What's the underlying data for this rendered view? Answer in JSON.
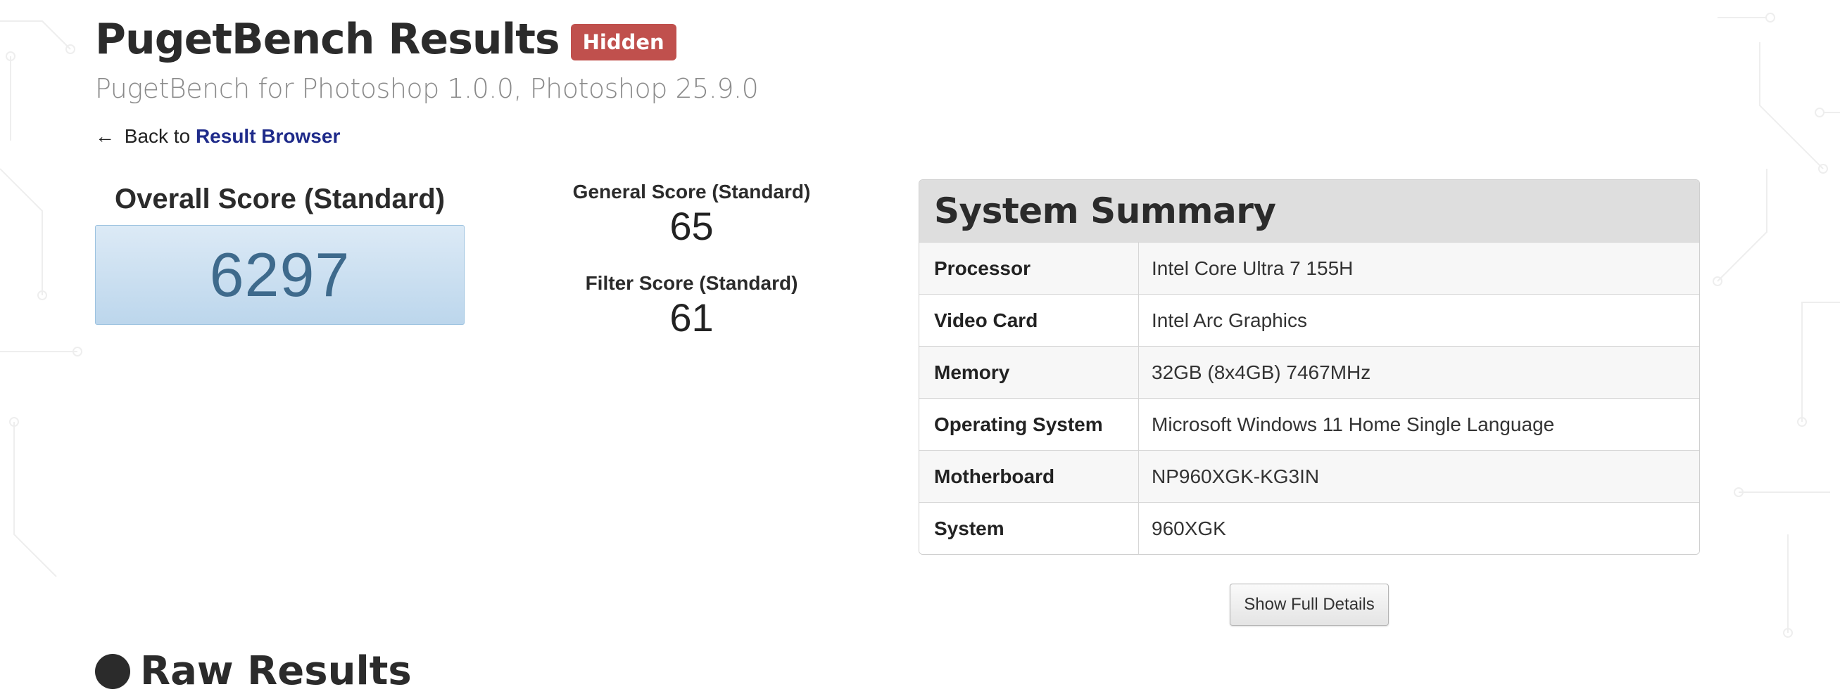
{
  "header": {
    "title": "PugetBench Results",
    "badge": "Hidden",
    "subtitle": "PugetBench for Photoshop 1.0.0, Photoshop 25.9.0"
  },
  "nav": {
    "back_arrow": "←",
    "back_prefix": "Back to",
    "back_link": "Result Browser"
  },
  "scores": {
    "overall": {
      "label": "Overall Score (Standard)",
      "value": "6297"
    },
    "general": {
      "label": "General Score (Standard)",
      "value": "65"
    },
    "filter": {
      "label": "Filter Score (Standard)",
      "value": "61"
    }
  },
  "system_summary": {
    "title": "System Summary",
    "rows": [
      {
        "key": "Processor",
        "value": "Intel Core Ultra 7 155H"
      },
      {
        "key": "Video Card",
        "value": "Intel Arc Graphics"
      },
      {
        "key": "Memory",
        "value": "32GB (8x4GB) 7467MHz"
      },
      {
        "key": "Operating System",
        "value": "Microsoft Windows 11 Home Single Language"
      },
      {
        "key": "Motherboard",
        "value": "NP960XGK-KG3IN"
      },
      {
        "key": "System",
        "value": "960XGK"
      }
    ],
    "button": "Show Full Details"
  },
  "next_section": {
    "heading": "Raw Results",
    "icon": "info-circle-icon"
  },
  "colors": {
    "badge": "#c0504d",
    "link": "#1f2b8a",
    "score_box": "#cfe1f2",
    "score_text": "#3e6a8c"
  }
}
